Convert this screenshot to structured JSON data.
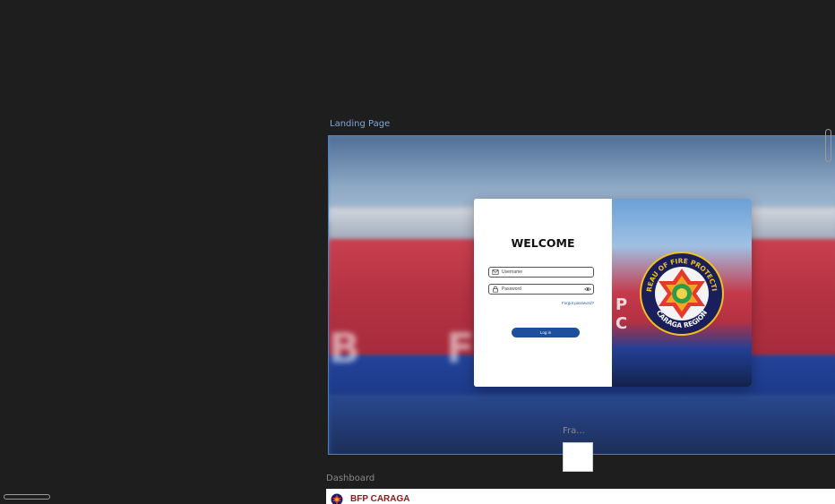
{
  "frames": {
    "landing_label": "Landing Page",
    "dashboard_label": "Dashboard",
    "small_frame_label": "Fra..."
  },
  "login": {
    "heading": "WELCOME",
    "username_placeholder": "Username",
    "password_placeholder": "Password",
    "forgot_label": "Forgot password?",
    "login_label": "Log in"
  },
  "background_letters": "B F",
  "seal": {
    "top_text": "BUREAU OF FIRE PROTECTION",
    "bottom_text": "CARAGA REGION"
  },
  "dashboard": {
    "title": "BFP CARAGA"
  },
  "colors": {
    "canvas": "#1e1e1e",
    "selection": "#3a86d8",
    "primary_button": "#1c4f9c",
    "brand_red": "#8b1a1a"
  },
  "icons": [
    "mail-icon",
    "lock-icon",
    "eye-icon",
    "bfp-seal-logo"
  ]
}
